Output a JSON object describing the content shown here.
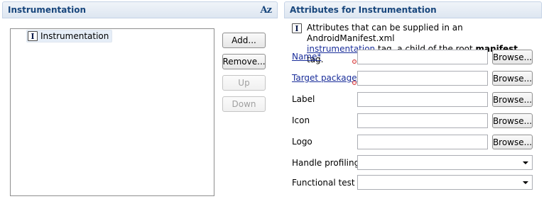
{
  "left_section": {
    "title": "Instrumentation",
    "sort_icon": "sort-alphabetical-icon",
    "sort_label": "Az",
    "tree_items": [
      {
        "icon_letter": "I",
        "label": "Instrumentation"
      }
    ],
    "buttons": {
      "add": "Add...",
      "remove": "Remove...",
      "up": "Up",
      "down": "Down"
    }
  },
  "right_section": {
    "title": "Attributes for Instrumentation",
    "description": {
      "icon_letter": "I",
      "prefix": "Attributes that can be supplied in an AndroidManifest.xml",
      "link": "instrumentation",
      "middle": " tag, a child of the root ",
      "bold": "manifest",
      "suffix": " tag."
    },
    "browse_label": "Browse...",
    "fields": [
      {
        "label": "Name*",
        "value": "",
        "required": true
      },
      {
        "label": "Target package",
        "value": "",
        "required": true
      },
      {
        "label": "Label",
        "value": ""
      },
      {
        "label": "Icon",
        "value": ""
      },
      {
        "label": "Logo",
        "value": ""
      }
    ],
    "combos": [
      {
        "label": "Handle profiling",
        "value": ""
      },
      {
        "label": "Functional test",
        "value": ""
      }
    ]
  }
}
